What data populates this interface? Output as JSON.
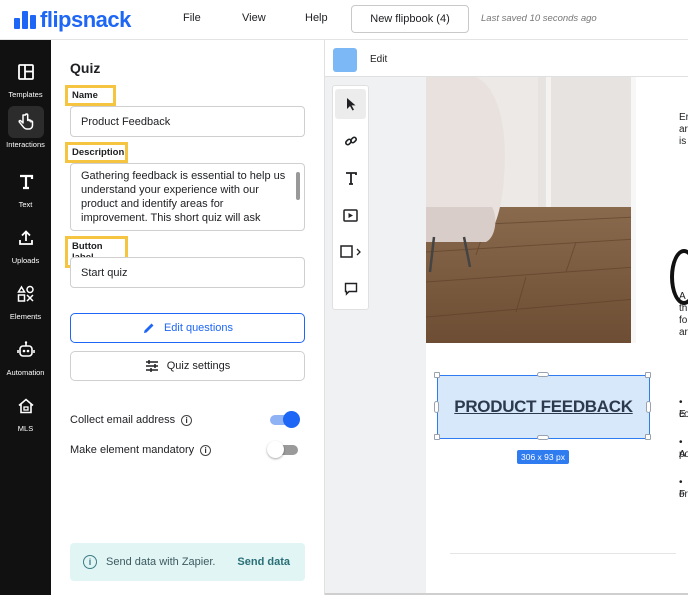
{
  "app": {
    "logo_text": "flipsnack",
    "brand_color": "#1e66f5"
  },
  "menu": {
    "file": "File",
    "view": "View",
    "help": "Help"
  },
  "document": {
    "name": "New flipbook (4)",
    "saved_status": "Last saved 10 seconds ago"
  },
  "rail": {
    "items": [
      {
        "label": "Templates",
        "icon": "layout-icon"
      },
      {
        "label": "Interactions",
        "icon": "hand-pointer-icon"
      },
      {
        "label": "Text",
        "icon": "text-icon"
      },
      {
        "label": "Uploads",
        "icon": "upload-icon"
      },
      {
        "label": "Elements",
        "icon": "shapes-icon"
      },
      {
        "label": "Automation",
        "icon": "robot-icon"
      },
      {
        "label": "MLS",
        "icon": "home-icon"
      }
    ]
  },
  "panel": {
    "title": "Quiz",
    "name_label": "Name",
    "name_value": "Product Feedback",
    "description_label": "Description",
    "description_value": "Gathering feedback is essential to help us understand your experience with our product and identify areas for improvement. This short quiz will ask",
    "button_label_label": "Button label",
    "button_label_value": "Start quiz",
    "edit_questions": "Edit questions",
    "quiz_settings": "Quiz settings",
    "collect_email": "Collect email address",
    "collect_email_on": true,
    "mandatory": "Make element mandatory",
    "mandatory_on": false,
    "zapier_text": "Send data with Zapier.",
    "zapier_button": "Send data"
  },
  "canvas": {
    "edit_label": "Edit",
    "swatch_color": "#7cb8f6",
    "selected_text": "PRODUCT FEEDBACK",
    "dimensions": "306 x 93 px",
    "side_snippets": [
      "Er",
      "ar",
      "is",
      "A",
      "th",
      "fo",
      "ar",
      "• E",
      "co",
      "• A",
      "po",
      "• F",
      "or"
    ]
  }
}
